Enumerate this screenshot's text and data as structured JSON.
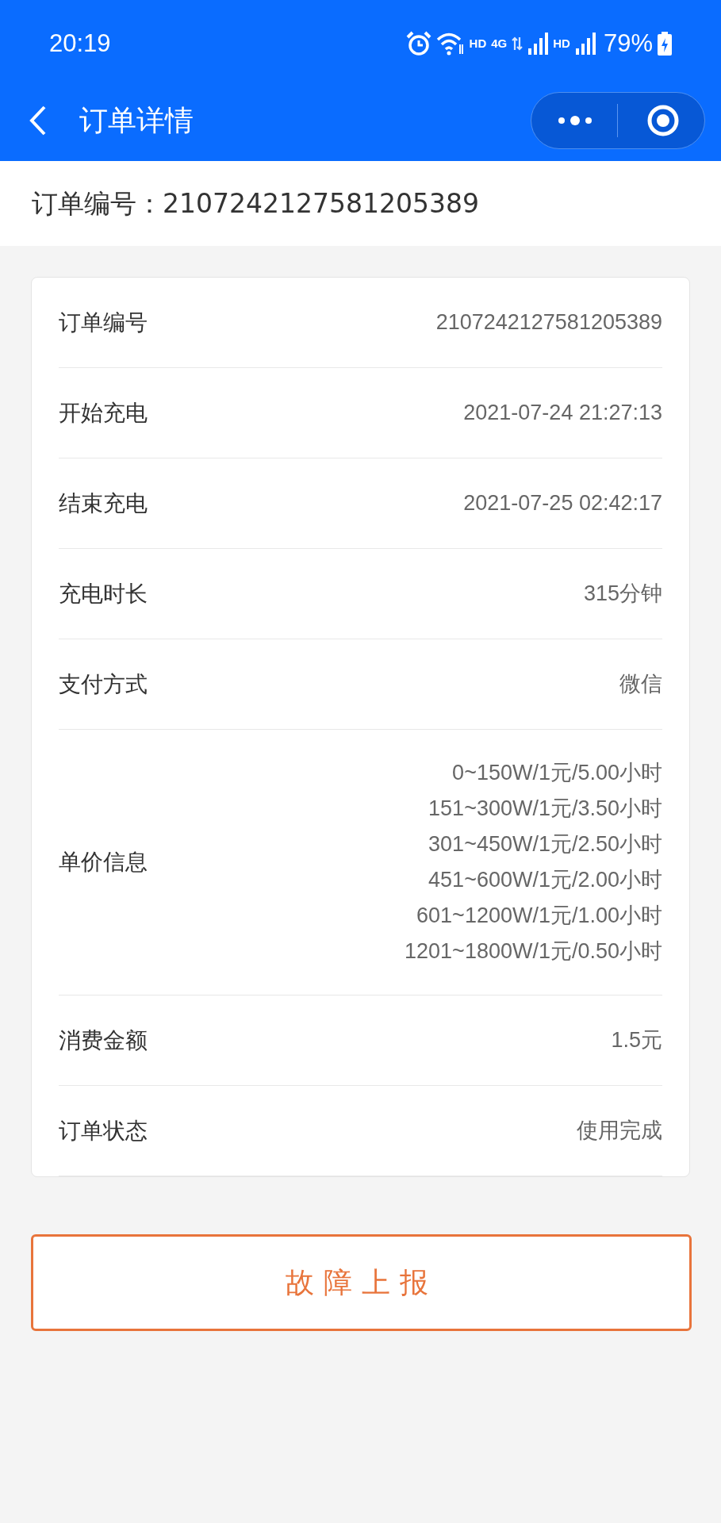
{
  "status_bar": {
    "time": "20:19",
    "network_labels": [
      "HD",
      "4G",
      "HD"
    ],
    "battery": "79%"
  },
  "nav": {
    "title": "订单详情"
  },
  "order_header": {
    "text": "订单编号：2107242127581205389"
  },
  "details": [
    {
      "label": "订单编号",
      "lines": [
        "2107242127581205389"
      ]
    },
    {
      "label": "开始充电",
      "lines": [
        "2021-07-24 21:27:13"
      ]
    },
    {
      "label": "结束充电",
      "lines": [
        "2021-07-25 02:42:17"
      ]
    },
    {
      "label": "充电时长",
      "lines": [
        "315分钟"
      ]
    },
    {
      "label": "支付方式",
      "lines": [
        "微信"
      ]
    },
    {
      "label": "单价信息",
      "lines": [
        "0~150W/1元/5.00小时",
        "151~300W/1元/3.50小时",
        "301~450W/1元/2.50小时",
        "451~600W/1元/2.00小时",
        "601~1200W/1元/1.00小时",
        "1201~1800W/1元/0.50小时"
      ]
    },
    {
      "label": "消费金额",
      "lines": [
        "1.5元"
      ]
    },
    {
      "label": "订单状态",
      "lines": [
        "使用完成"
      ]
    }
  ],
  "report_button": {
    "label": "故障上报"
  }
}
